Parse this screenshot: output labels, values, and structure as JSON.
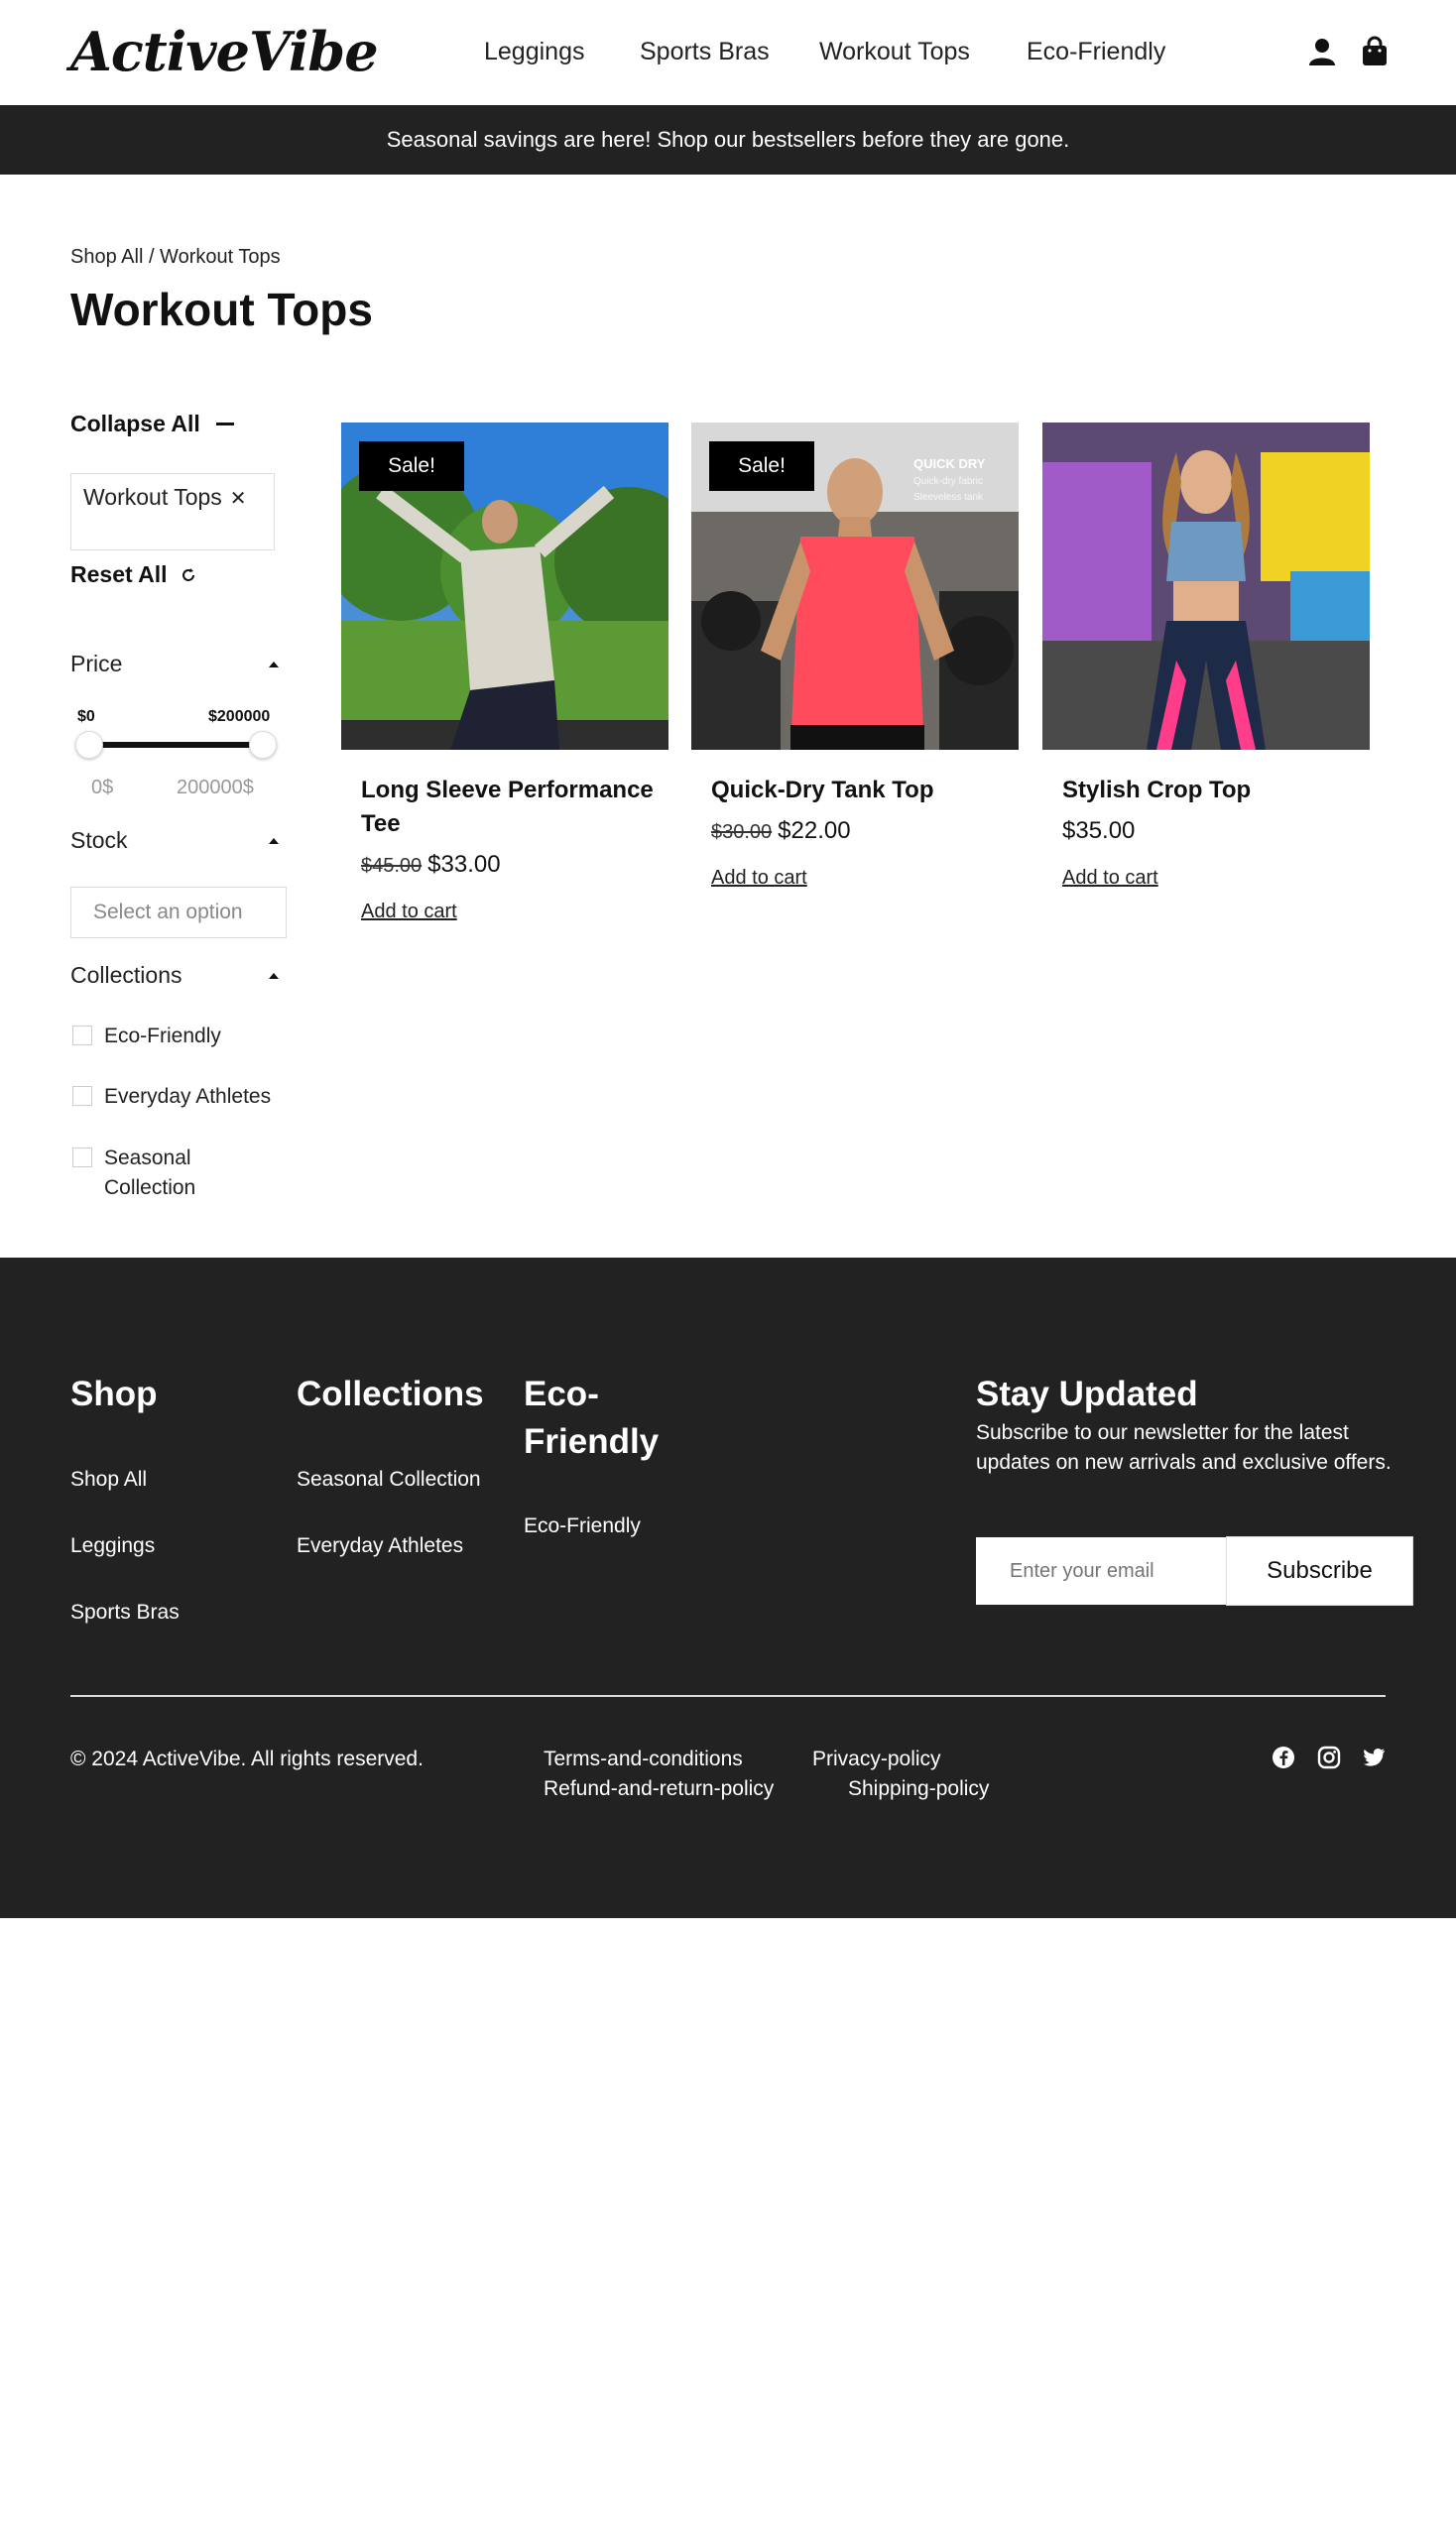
{
  "header": {
    "logo": "ActiveVibe",
    "nav": [
      "Leggings",
      "Sports Bras",
      "Workout Tops",
      "Eco-Friendly"
    ],
    "icons": [
      "user-icon",
      "bag-icon"
    ]
  },
  "announcement": "Seasonal savings are here! Shop our bestsellers before they are gone.",
  "breadcrumb": "Shop All / Workout Tops",
  "page_title": "Workout Tops",
  "filters": {
    "collapse_all": "Collapse All",
    "active_chip": "Workout Tops",
    "reset_all": "Reset All",
    "price": {
      "title": "Price",
      "min_label": "$0",
      "max_label": "$200000",
      "min_value": "0$",
      "max_value": "200000$",
      "range_low_fraction": 0,
      "range_high_fraction": 1
    },
    "stock": {
      "title": "Stock",
      "placeholder": "Select an option"
    },
    "collections": {
      "title": "Collections",
      "options": [
        "Eco-Friendly",
        "Everyday Athletes",
        "Seasonal Collection"
      ]
    }
  },
  "products": [
    {
      "title": "Long Sleeve Performance Tee",
      "sale_badge": "Sale!",
      "old_price": "$45.00",
      "price": "$33.00",
      "cta": "Add to cart"
    },
    {
      "title": "Quick-Dry Tank Top",
      "sale_badge": "Sale!",
      "old_price": "$30.00",
      "price": "$22.00",
      "cta": "Add to cart",
      "image_text": [
        "QUICK DRY",
        "Quick-dry fabric",
        "Sleeveless tank"
      ]
    },
    {
      "title": "Stylish Crop Top",
      "sale_badge": "",
      "old_price": "",
      "price": "$35.00",
      "cta": "Add to cart"
    }
  ],
  "footer": {
    "shop": {
      "title": "Shop",
      "links": [
        "Shop All",
        "Leggings",
        "Sports Bras"
      ]
    },
    "collections": {
      "title": "Collections",
      "links": [
        "Seasonal Collection",
        "Everyday Athletes"
      ]
    },
    "eco": {
      "title": "Eco-Friendly",
      "links": [
        "Eco-Friendly"
      ]
    },
    "newsletter": {
      "title": "Stay Updated",
      "text": "Subscribe to our newsletter for the latest updates on new arrivals and exclusive offers.",
      "placeholder": "Enter your email",
      "button": "Subscribe"
    },
    "copyright": "© 2024 ActiveVibe. All rights reserved.",
    "legal": [
      "Terms-and-conditions",
      "Privacy-policy",
      "Refund-and-return-policy",
      "Shipping-policy"
    ],
    "social": [
      "facebook-icon",
      "instagram-icon",
      "twitter-icon"
    ]
  },
  "colors": {
    "dark": "#222222",
    "accent_pink": "#ff4b5c",
    "white": "#ffffff"
  }
}
